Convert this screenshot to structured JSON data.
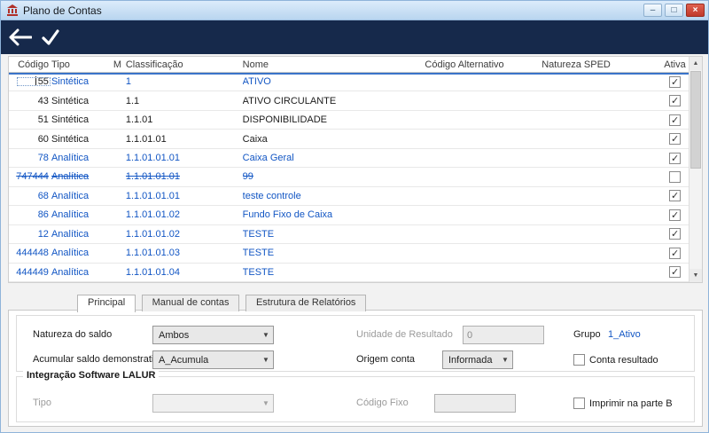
{
  "window": {
    "title": "Plano de Contas",
    "minimize_glyph": "–",
    "maximize_glyph": "□",
    "close_glyph": "×"
  },
  "icons": {
    "back": "arrow-left",
    "confirm": "checkmark",
    "scroll_up": "▲",
    "scroll_down": "▼",
    "combo_arrow": "▼",
    "check": "✓"
  },
  "colors": {
    "titlebar": "#bcd7f0",
    "toolbar": "#16294b",
    "accent_blue": "#1256c4",
    "close_red": "#c0392b"
  },
  "grid": {
    "columns": [
      {
        "key": "codigo",
        "label": "Código"
      },
      {
        "key": "tipo",
        "label": "Tipo"
      },
      {
        "key": "m",
        "label": "M"
      },
      {
        "key": "classificacao",
        "label": "Classificação"
      },
      {
        "key": "nome",
        "label": "Nome"
      },
      {
        "key": "codigo_alternativo",
        "label": "Código Alternativo"
      },
      {
        "key": "natureza_sped",
        "label": "Natureza SPED"
      },
      {
        "key": "ativa",
        "label": "Ativa"
      }
    ],
    "rows": [
      {
        "codigo": "55",
        "tipo": "Sintética",
        "m": "",
        "classificacao": "1",
        "nome": "ATIVO",
        "codigo_alternativo": "",
        "natureza_sped": "",
        "ativa": true,
        "selected": true,
        "text_color": "blue",
        "strike": false
      },
      {
        "codigo": "43",
        "tipo": "Sintética",
        "m": "",
        "classificacao": "1.1",
        "nome": "ATIVO CIRCULANTE",
        "codigo_alternativo": "",
        "natureza_sped": "",
        "ativa": true,
        "selected": false,
        "text_color": "black",
        "strike": false
      },
      {
        "codigo": "51",
        "tipo": "Sintética",
        "m": "",
        "classificacao": "1.1.01",
        "nome": "DISPONIBILIDADE",
        "codigo_alternativo": "",
        "natureza_sped": "",
        "ativa": true,
        "selected": false,
        "text_color": "black",
        "strike": false
      },
      {
        "codigo": "60",
        "tipo": "Sintética",
        "m": "",
        "classificacao": "1.1.01.01",
        "nome": "Caixa",
        "codigo_alternativo": "",
        "natureza_sped": "",
        "ativa": true,
        "selected": false,
        "text_color": "black",
        "strike": false
      },
      {
        "codigo": "78",
        "tipo": "Analítica",
        "m": "",
        "classificacao": "1.1.01.01.01",
        "nome": "Caixa Geral",
        "codigo_alternativo": "",
        "natureza_sped": "",
        "ativa": true,
        "selected": false,
        "text_color": "blue",
        "strike": false
      },
      {
        "codigo": "747444",
        "tipo": "Analítica",
        "m": "",
        "classificacao": "1.1.01.01.01",
        "nome": "99",
        "codigo_alternativo": "",
        "natureza_sped": "",
        "ativa": false,
        "selected": false,
        "text_color": "blue",
        "strike": true
      },
      {
        "codigo": "68",
        "tipo": "Analítica",
        "m": "",
        "classificacao": "1.1.01.01.01",
        "nome": "teste controle",
        "codigo_alternativo": "",
        "natureza_sped": "",
        "ativa": true,
        "selected": false,
        "text_color": "blue",
        "strike": false
      },
      {
        "codigo": "86",
        "tipo": "Analítica",
        "m": "",
        "classificacao": "1.1.01.01.02",
        "nome": "Fundo Fixo de Caixa",
        "codigo_alternativo": "",
        "natureza_sped": "",
        "ativa": true,
        "selected": false,
        "text_color": "blue",
        "strike": false
      },
      {
        "codigo": "12",
        "tipo": "Analítica",
        "m": "",
        "classificacao": "1.1.01.01.02",
        "nome": "TESTE",
        "codigo_alternativo": "",
        "natureza_sped": "",
        "ativa": true,
        "selected": false,
        "text_color": "blue",
        "strike": false
      },
      {
        "codigo": "444448",
        "tipo": "Analítica",
        "m": "",
        "classificacao": "1.1.01.01.03",
        "nome": "TESTE",
        "codigo_alternativo": "",
        "natureza_sped": "",
        "ativa": true,
        "selected": false,
        "text_color": "blue",
        "strike": false
      },
      {
        "codigo": "444449",
        "tipo": "Analítica",
        "m": "",
        "classificacao": "1.1.01.01.04",
        "nome": "TESTE",
        "codigo_alternativo": "",
        "natureza_sped": "",
        "ativa": true,
        "selected": false,
        "text_color": "blue",
        "strike": false
      }
    ]
  },
  "tabs": [
    {
      "label": "Principal",
      "active": true
    },
    {
      "label": "Manual de contas",
      "active": false
    },
    {
      "label": "Estrutura de Relatórios",
      "active": false
    }
  ],
  "form": {
    "natureza_saldo_label": "Natureza do saldo",
    "natureza_saldo_value": "Ambos",
    "unidade_resultado_label": "Unidade de Resultado",
    "unidade_resultado_value": "0",
    "grupo_label": "Grupo",
    "grupo_value": "1_Ativo",
    "acumular_label": "Acumular saldo demonstrativo",
    "acumular_value": "A_Acumula",
    "origem_label": "Origem conta",
    "origem_value": "Informada",
    "conta_resultado_label": "Conta resultado",
    "conta_resultado_checked": false,
    "lalur_title": "Integração Software LALUR",
    "lalur_tipo_label": "Tipo",
    "lalur_tipo_value": "",
    "lalur_codigo_fixo_label": "Código Fixo",
    "lalur_codigo_fixo_value": "",
    "imprimir_label": "Imprimir na parte B",
    "imprimir_checked": false
  }
}
